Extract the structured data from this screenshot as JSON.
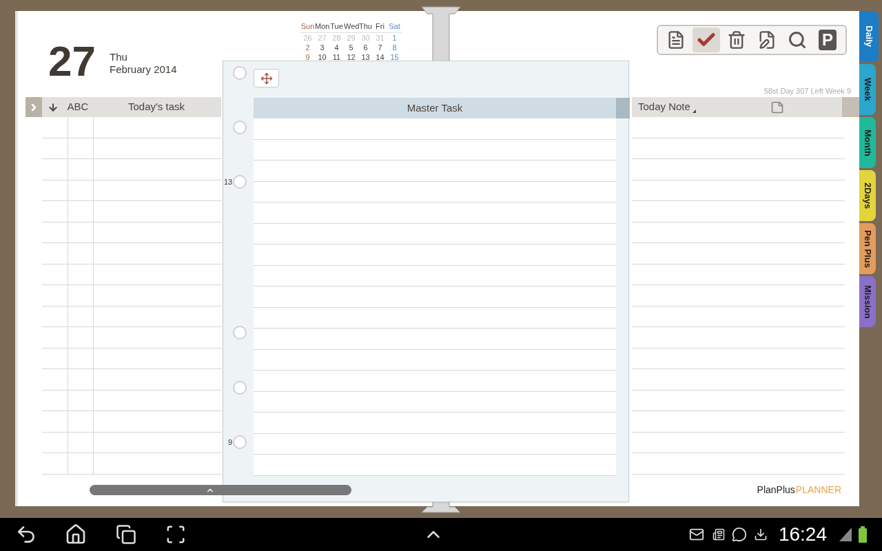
{
  "date": {
    "day": "27",
    "weekday": "Thu",
    "month_year": "February 2014"
  },
  "mini_calendar": {
    "weekdays": [
      "Sun",
      "Mon",
      "Tue",
      "Wed",
      "Thu",
      "Fri",
      "Sat"
    ],
    "weeks": [
      [
        {
          "d": "26",
          "muted": true
        },
        {
          "d": "27",
          "muted": true
        },
        {
          "d": "28",
          "muted": true
        },
        {
          "d": "29",
          "muted": true
        },
        {
          "d": "30",
          "muted": true
        },
        {
          "d": "31",
          "muted": true
        },
        {
          "d": "1",
          "muted": false
        }
      ],
      [
        {
          "d": "2",
          "muted": false
        },
        {
          "d": "3",
          "muted": false
        },
        {
          "d": "4",
          "muted": false
        },
        {
          "d": "5",
          "muted": false
        },
        {
          "d": "6",
          "muted": false
        },
        {
          "d": "7",
          "muted": false
        },
        {
          "d": "8",
          "muted": false
        }
      ],
      [
        {
          "d": "9",
          "muted": false
        },
        {
          "d": "10",
          "muted": false
        },
        {
          "d": "11",
          "muted": false
        },
        {
          "d": "12",
          "muted": false
        },
        {
          "d": "13",
          "muted": false
        },
        {
          "d": "14",
          "muted": false
        },
        {
          "d": "15",
          "muted": false
        }
      ]
    ]
  },
  "toolbar": [
    {
      "kind": "document",
      "selected": false
    },
    {
      "kind": "check",
      "selected": true
    },
    {
      "kind": "trash",
      "selected": false
    },
    {
      "kind": "edit",
      "selected": false
    },
    {
      "kind": "search",
      "selected": false
    },
    {
      "kind": "letter",
      "label": "P",
      "selected": false
    }
  ],
  "day_info": "58st Day 307 Left Week 9",
  "task_table": {
    "columns": [
      "ABC",
      "Today's task"
    ]
  },
  "note_panel": {
    "title": "Today Note"
  },
  "master_task_popup": {
    "title": "Master Task",
    "hour_marks": [
      "13",
      "9"
    ]
  },
  "logo": {
    "brand": "PlanPlus",
    "product": "PLANNER"
  },
  "side_tabs": [
    {
      "label": "Daily",
      "color": "#1a7dc6",
      "selected": true
    },
    {
      "label": "Week",
      "color": "#2ba6cc",
      "selected": false
    },
    {
      "label": "Month",
      "color": "#1fb99b",
      "selected": false
    },
    {
      "label": "2Days",
      "color": "#e2d43a",
      "selected": false
    },
    {
      "label": "Pen Plus",
      "color": "#e39c5c",
      "selected": false
    },
    {
      "label": "Mission",
      "color": "#8a70c9",
      "selected": false
    }
  ],
  "status_bar": {
    "time": "16:24"
  }
}
